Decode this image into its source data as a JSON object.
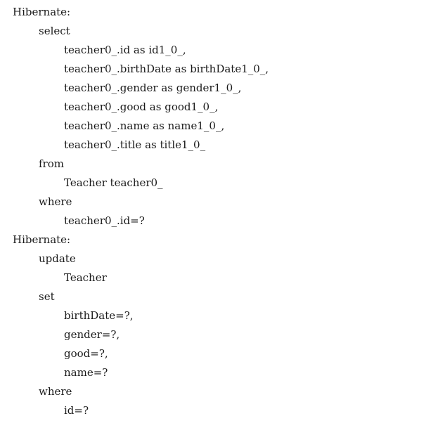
{
  "lines": [
    {
      "indent": 0,
      "text": "Hibernate:"
    },
    {
      "indent": 1,
      "text": "select"
    },
    {
      "indent": 2,
      "text": "teacher0_.id as id1_0_,"
    },
    {
      "indent": 2,
      "text": "teacher0_.birthDate as birthDate1_0_,"
    },
    {
      "indent": 2,
      "text": "teacher0_.gender as gender1_0_,"
    },
    {
      "indent": 2,
      "text": "teacher0_.good as good1_0_,"
    },
    {
      "indent": 2,
      "text": "teacher0_.name as name1_0_,"
    },
    {
      "indent": 2,
      "text": "teacher0_.title as title1_0_"
    },
    {
      "indent": 1,
      "text": "from"
    },
    {
      "indent": 2,
      "text": "Teacher teacher0_"
    },
    {
      "indent": 1,
      "text": "where"
    },
    {
      "indent": 2,
      "text": "teacher0_.id=?"
    },
    {
      "indent": 0,
      "text": "Hibernate:"
    },
    {
      "indent": 1,
      "text": "update"
    },
    {
      "indent": 2,
      "text": "Teacher"
    },
    {
      "indent": 1,
      "text": "set"
    },
    {
      "indent": 2,
      "text": "birthDate=?,"
    },
    {
      "indent": 2,
      "text": "gender=?,"
    },
    {
      "indent": 2,
      "text": "good=?,"
    },
    {
      "indent": 2,
      "text": "name=?"
    },
    {
      "indent": 1,
      "text": "where"
    },
    {
      "indent": 2,
      "text": "id=?"
    }
  ]
}
